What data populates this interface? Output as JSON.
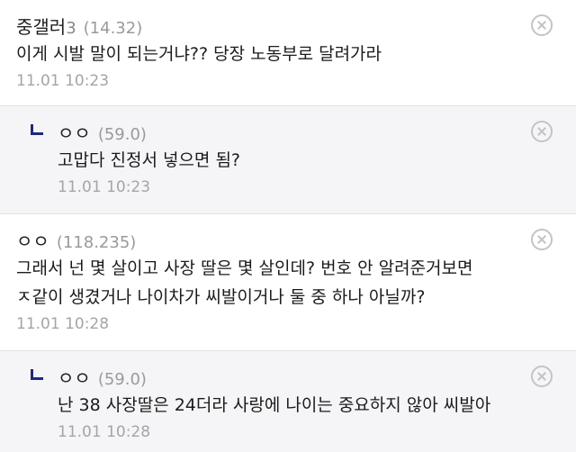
{
  "comments": [
    {
      "nick": "중갤러",
      "nick_suffix": "3",
      "ip": "(14.32)",
      "text": "이게 시발 말이 되는거냐?? 당장 노동부로 달려가라",
      "time": "11.01 10:23",
      "delete_icon": "circle-x-icon"
    },
    {
      "nick": "ㅇㅇ",
      "ip": "(59.0)",
      "text": "고맙다 진정서 넣으면 됨?",
      "time": "11.01 10:23",
      "delete_icon": "circle-x-icon"
    },
    {
      "nick": "ㅇㅇ",
      "ip": "(118.235)",
      "text": "그래서 넌 몇 살이고 사장 딸은 몇 살인데? 번호 안 알려준거보면 ㅈ같이 생겼거나 나이차가 씨발이거나 둘 중 하나 아닐까?",
      "time": "11.01 10:28",
      "delete_icon": "circle-x-icon"
    },
    {
      "nick": "ㅇㅇ",
      "ip": "(59.0)",
      "text": "난 38 사장딸은 24더라 사랑에 나이는 중요하지 않아 씨발아",
      "time": "11.01 10:28",
      "delete_icon": "circle-x-icon"
    }
  ],
  "colors": {
    "reply_bg": "#f5f5f7",
    "reply_arrow": "#1e2a78",
    "meta_gray": "#9a9a9a",
    "divider": "#e2e2e2"
  }
}
